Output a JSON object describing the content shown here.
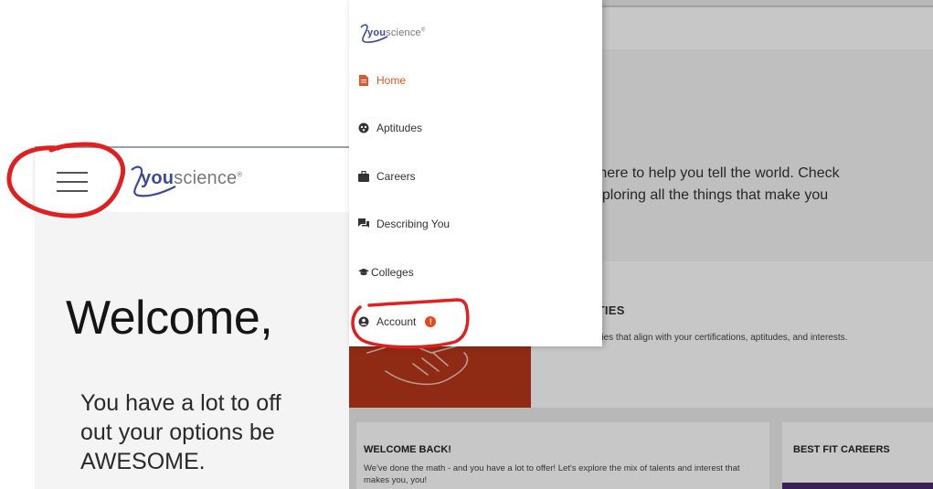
{
  "left": {
    "logo_bold": "you",
    "logo_rest": "science",
    "welcome_title": "Welcome,",
    "welcome_lines": [
      "You have a lot to off",
      "out your options be",
      "AWESOME."
    ]
  },
  "right": {
    "hero_lines": [
      "e here to help you tell the world. Check",
      "exploring all the things that make you"
    ],
    "opportunities_title": "NITIES",
    "opportunities_desc": "stry opportunities that align with your certifications, aptitudes, and interests.",
    "welcome_back_title": "WELCOME BACK!",
    "welcome_back_desc": "We've done the math - and you have a lot to offer! Let's explore the mix of talents and interest that makes you, you!",
    "best_fit_title": "BEST FIT CAREERS"
  },
  "drawer": {
    "logo_bold": "you",
    "logo_rest": "science",
    "items": [
      {
        "label": "Home",
        "icon": "document-icon"
      },
      {
        "label": "Aptitudes",
        "icon": "aptitude-icon"
      },
      {
        "label": "Careers",
        "icon": "briefcase-icon"
      },
      {
        "label": "Describing You",
        "icon": "chat-icon"
      },
      {
        "label": "Colleges",
        "icon": "graduation-cap-icon"
      },
      {
        "label": "Account",
        "icon": "user-icon"
      }
    ],
    "account_alert": "!"
  },
  "colors": {
    "accent": "#e0582a",
    "brand_blue": "#3b4a9a",
    "annotation_red": "#e02020",
    "opportunity_image": "#b8361b",
    "best_fit_bar": "#4b2a6b"
  }
}
